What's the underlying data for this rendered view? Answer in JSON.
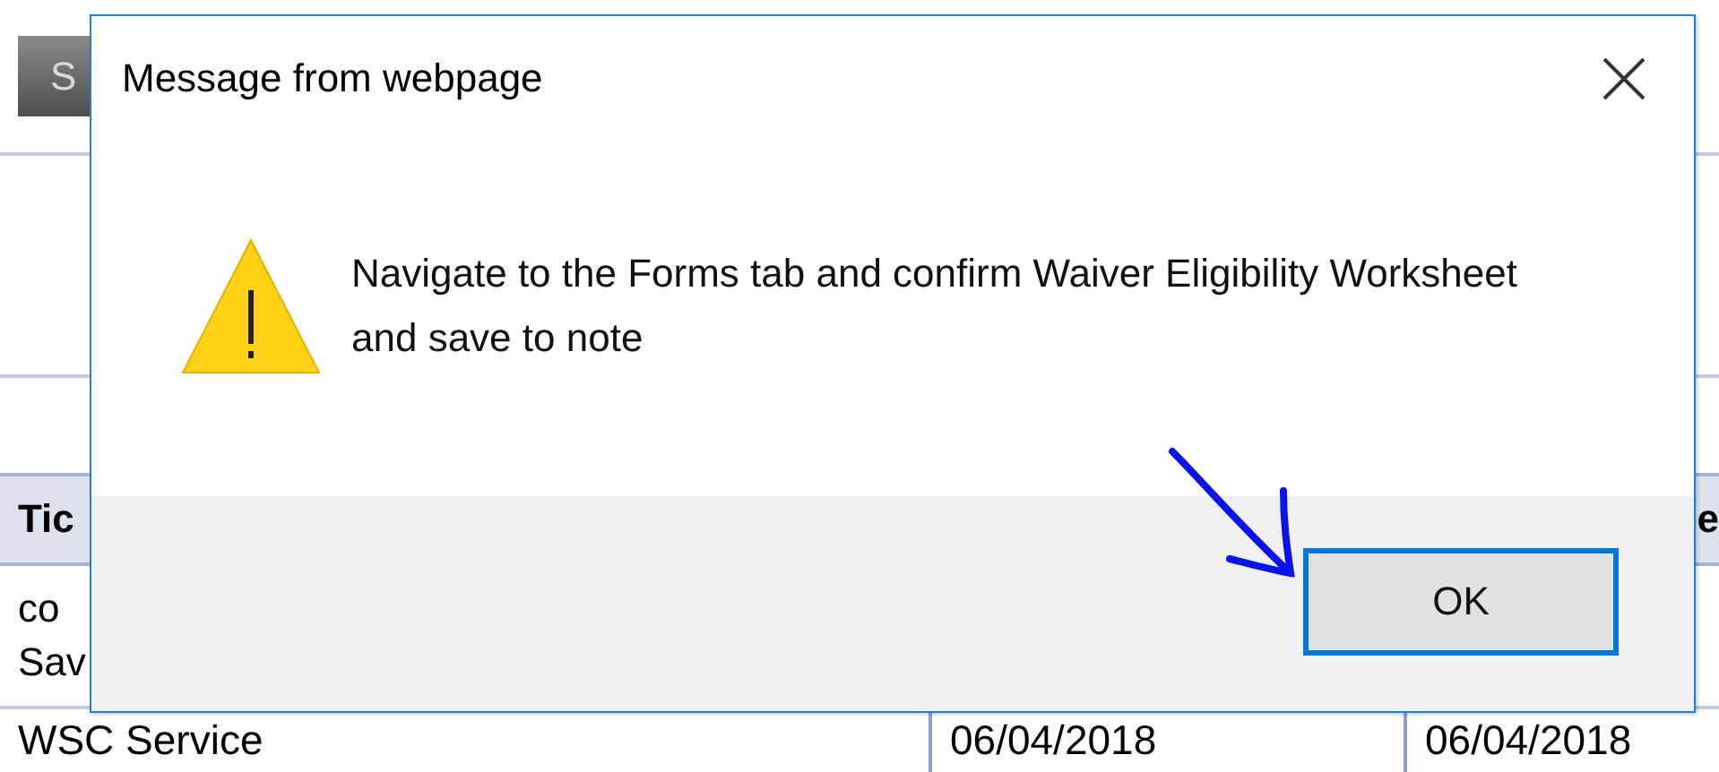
{
  "page": {
    "button": "S",
    "header": {
      "column_1": "Tic",
      "column_4": "e"
    },
    "rows": [
      {
        "lines": [
          "co",
          "Sav"
        ]
      },
      {
        "cells": [
          "WSC Service",
          "06/04/2018",
          "06/04/2018"
        ]
      }
    ]
  },
  "dialog": {
    "title": "Message from webpage",
    "message": "Navigate to the Forms tab and confirm Waiver Eligibility Worksheet and save to note",
    "buttons": [
      {
        "label": "OK",
        "focused": true
      }
    ]
  }
}
